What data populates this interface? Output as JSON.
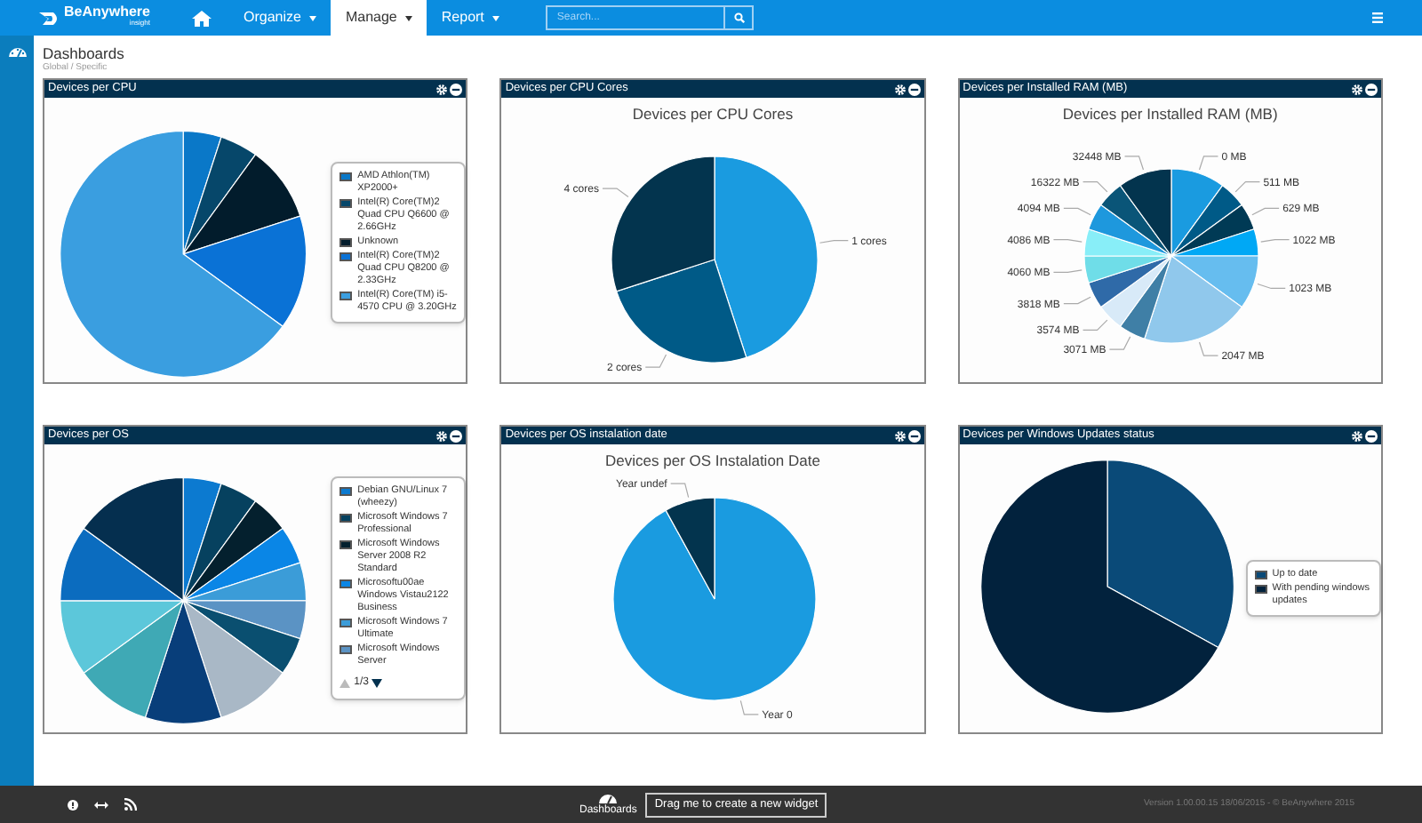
{
  "nav": {
    "brand": "BeAnywhere",
    "brand_sub": "insight",
    "items": [
      {
        "label": "Organize",
        "selected": false
      },
      {
        "label": "Manage",
        "selected": true
      },
      {
        "label": "Report",
        "selected": false
      }
    ],
    "search": {
      "placeholder": "Search..."
    }
  },
  "page": {
    "title": "Dashboards",
    "subtitle": "Global / Specific"
  },
  "widgets": [
    {
      "kind": "legend",
      "title": "Devices per CPU",
      "chart_data": {
        "type": "pie",
        "categories": [
          "AMD Athlon(TM) XP2000+",
          "Intel(R) Core(TM)2 Quad CPU Q6600 @ 2.66GHz",
          "Unknown",
          "Intel(R) Core(TM)2 Quad CPU Q8200 @ 2.33GHz",
          "Intel(R) Core(TM) i5-4570 CPU @ 3.20GHz"
        ],
        "values": [
          5,
          5,
          10,
          15,
          65
        ],
        "colors": [
          "#0a78c8",
          "#06476a",
          "#021c2c",
          "#0a72d6",
          "#3a9ee0"
        ]
      }
    },
    {
      "kind": "labels",
      "title": "Devices per CPU Cores",
      "chart_data": {
        "type": "pie",
        "title": "Devices per CPU Cores",
        "categories": [
          "1 cores",
          "2 cores",
          "4 cores"
        ],
        "values": [
          45,
          25,
          30
        ],
        "colors": [
          "#1a9be0",
          "#005a87",
          "#03344e"
        ]
      }
    },
    {
      "kind": "labels",
      "title": "Devices per Installed RAM (MB)",
      "chart_data": {
        "type": "pie",
        "title": "Devices per Installed RAM (MB)",
        "categories": [
          "0 MB",
          "511 MB",
          "629 MB",
          "1022 MB",
          "1023 MB",
          "2047 MB",
          "3071 MB",
          "3574 MB",
          "3818 MB",
          "4060 MB",
          "4086 MB",
          "4094 MB",
          "16322 MB",
          "32448 MB"
        ],
        "values": [
          10,
          5,
          5,
          5,
          10,
          20,
          5,
          5,
          5,
          5,
          5,
          5,
          5,
          10
        ],
        "colors": [
          "#1a9be0",
          "#005a87",
          "#003a55",
          "#00a8f5",
          "#66bdef",
          "#90c8ec",
          "#3f7fa6",
          "#d8eaf8",
          "#2f6aa8",
          "#6fdde8",
          "#88eef8",
          "#1e98dd",
          "#0a5578",
          "#03344e"
        ]
      }
    },
    {
      "kind": "os",
      "title": "Devices per OS",
      "legend": [
        {
          "label": "Debian GNU/Linux 7 (wheezy)",
          "color": "#0c7ad0"
        },
        {
          "label": "Microsoft Windows 7 Professional",
          "color": "#06415f"
        },
        {
          "label": "Microsoft Windows Server 2008 R2 Standard",
          "color": "#04202e"
        },
        {
          "label": "Microsoftu00ae Windows Vistau2122 Business",
          "color": "#0a86e6"
        },
        {
          "label": "Microsoft Windows 7 Ultimate",
          "color": "#3b9cd8"
        },
        {
          "label": "Microsoft Windows Server",
          "color": "#5b93c4"
        }
      ],
      "pager": "1/3"
    },
    {
      "kind": "labels",
      "title": "Devices per OS instalation date",
      "chart_data": {
        "type": "pie",
        "title": "Devices per OS Instalation Date",
        "categories": [
          "Year 0",
          "Year undef"
        ],
        "values": [
          92,
          8
        ],
        "colors": [
          "#1a9be0",
          "#03344e"
        ]
      }
    },
    {
      "kind": "legend",
      "title": "Devices per Windows Updates status",
      "chart_data": {
        "type": "pie",
        "categories": [
          "Up to date",
          "With pending windows updates"
        ],
        "values": [
          33,
          67
        ],
        "colors": [
          "#0a4a78",
          "#02223d"
        ]
      }
    }
  ],
  "footer": {
    "dashboards": "Dashboards",
    "drag_button": "Drag me to create a new widget",
    "version": "Version 1.00.00.15 18/06/2015 - © BeAnywhere 2015"
  }
}
